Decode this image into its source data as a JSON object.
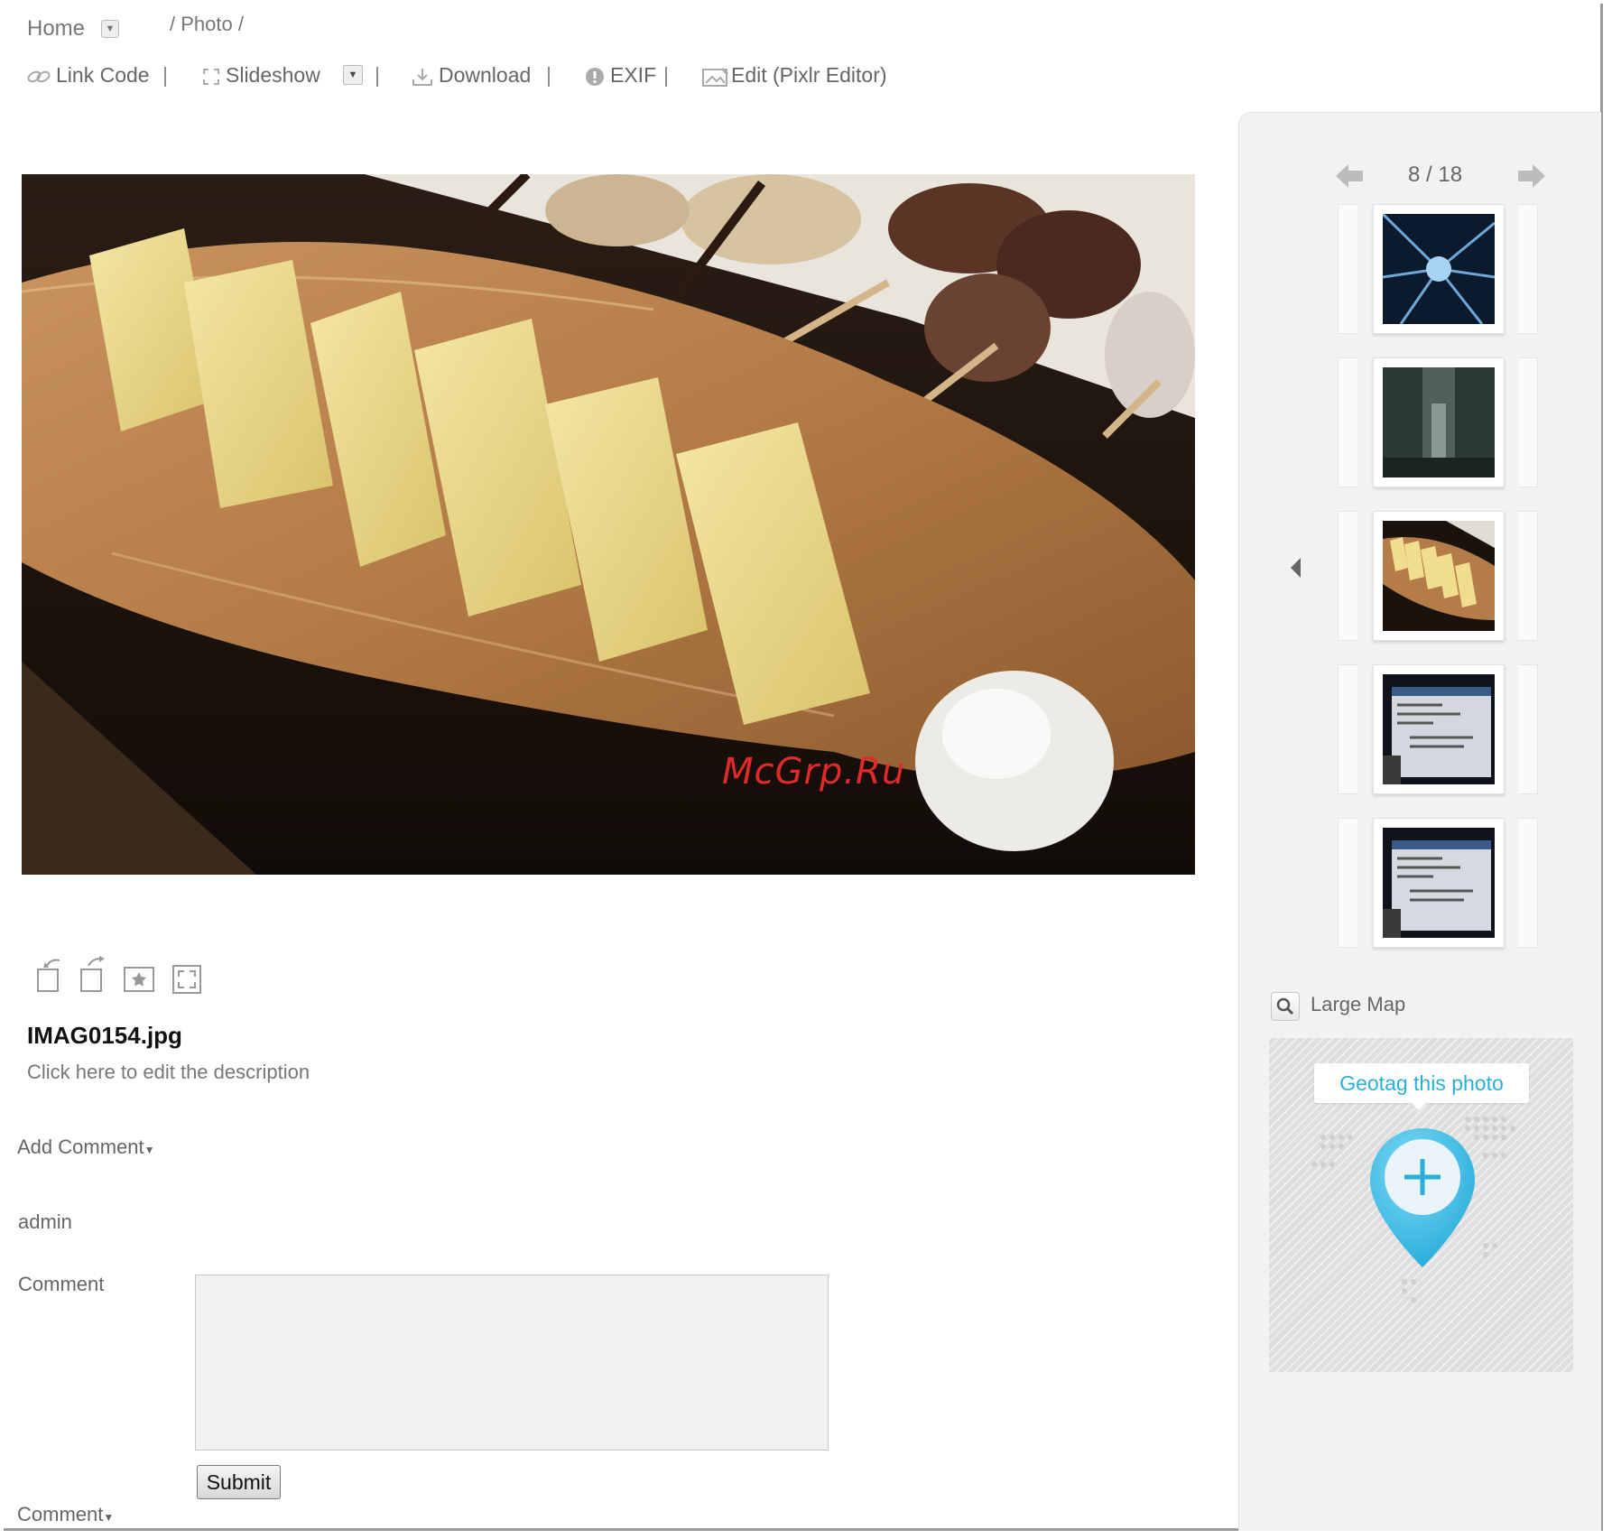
{
  "breadcrumb": {
    "home": "Home",
    "photo": "/ Photo /"
  },
  "toolbar": {
    "link_code": "Link Code",
    "slideshow": "Slideshow",
    "download": "Download",
    "exif": "EXIF",
    "edit": "Edit (Pixlr Editor)",
    "separator": "|"
  },
  "photo": {
    "filename": "IMAG0154.jpg",
    "description": "Click here to edit the description",
    "watermark": "McGrp.Ru"
  },
  "comments": {
    "add_comment": "Add Comment",
    "user": "admin",
    "comment_label": "Comment",
    "submit": "Submit",
    "footer": "Comment"
  },
  "sidebar": {
    "pager": "8 / 18",
    "large_map": "Large Map",
    "geotag": "Geotag this photo"
  }
}
